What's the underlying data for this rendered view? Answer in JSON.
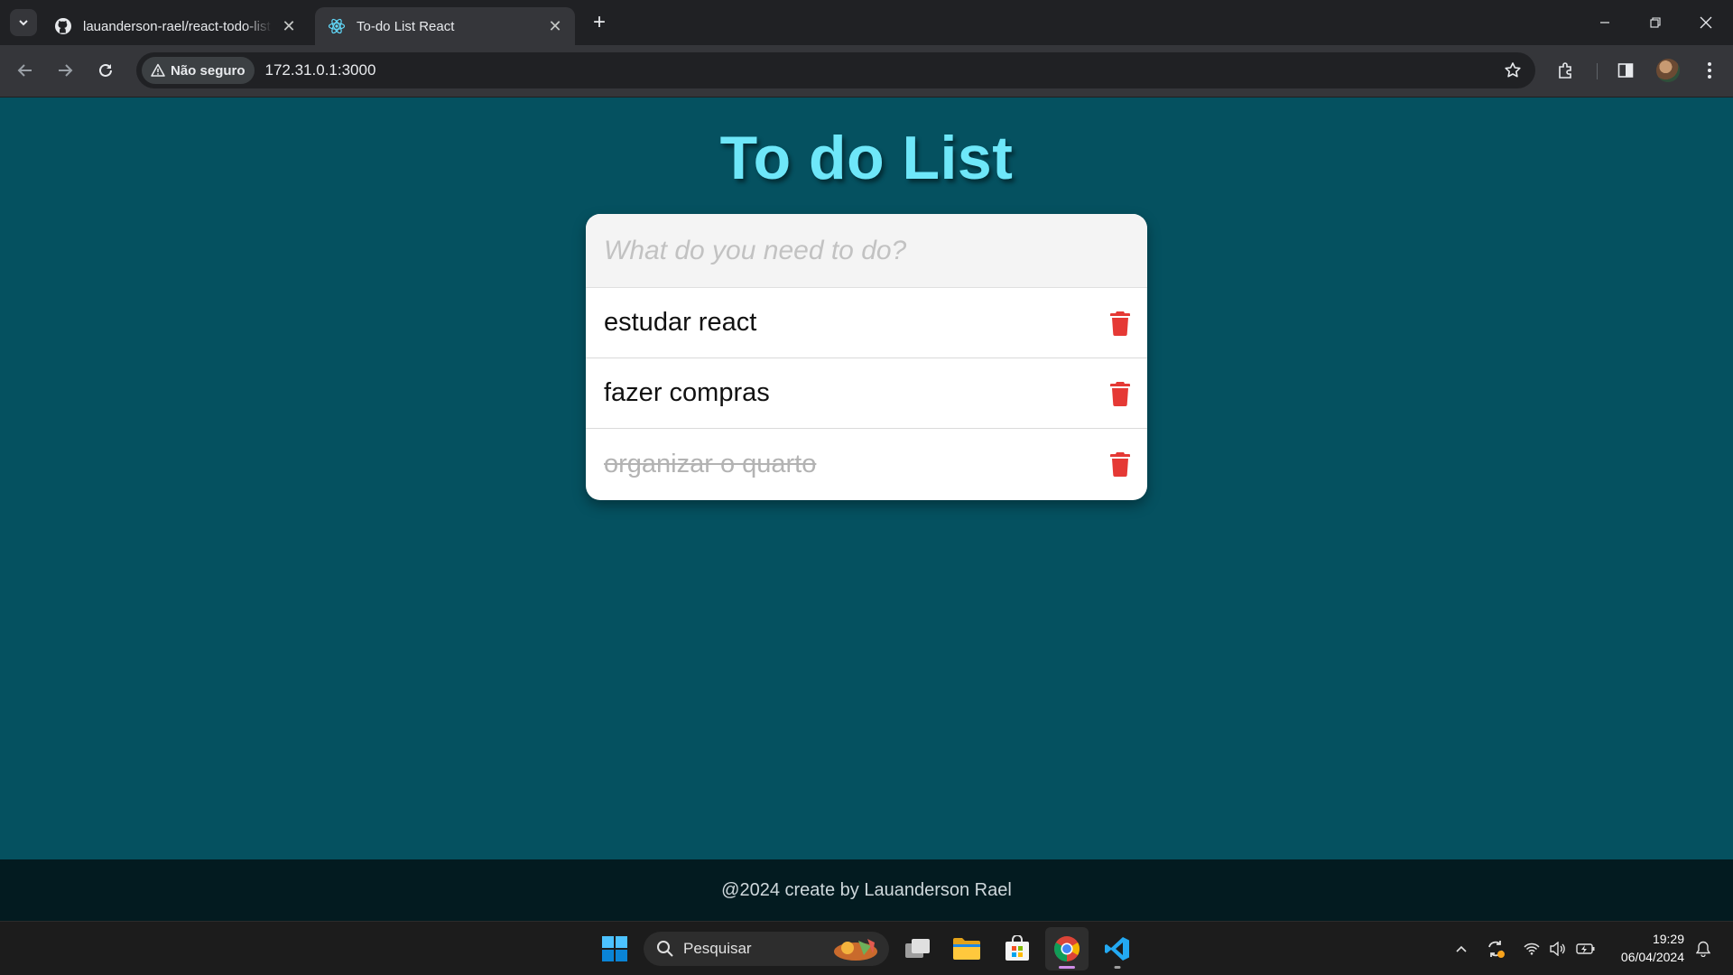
{
  "browser": {
    "tabs": [
      {
        "title": "lauanderson-rael/react-todo-list",
        "icon": "github-icon",
        "active": false
      },
      {
        "title": "To-do List React",
        "icon": "react-icon",
        "active": true
      }
    ],
    "security_label": "Não seguro",
    "url": "172.31.0.1:3000"
  },
  "app": {
    "title": "To do List",
    "input": {
      "placeholder": "What do you need to do?",
      "value": ""
    },
    "todos": [
      {
        "text": "estudar react",
        "done": false
      },
      {
        "text": "fazer compras",
        "done": false
      },
      {
        "text": "organizar o quarto",
        "done": true
      }
    ],
    "footer": "@2024 create by Lauanderson Rael"
  },
  "taskbar": {
    "search_label": "Pesquisar",
    "time": "19:29",
    "date": "06/04/2024"
  },
  "colors": {
    "page_background": "#055160",
    "title": "#6ee7f9",
    "trash": "#e53935",
    "footer_background": "#031b20"
  }
}
